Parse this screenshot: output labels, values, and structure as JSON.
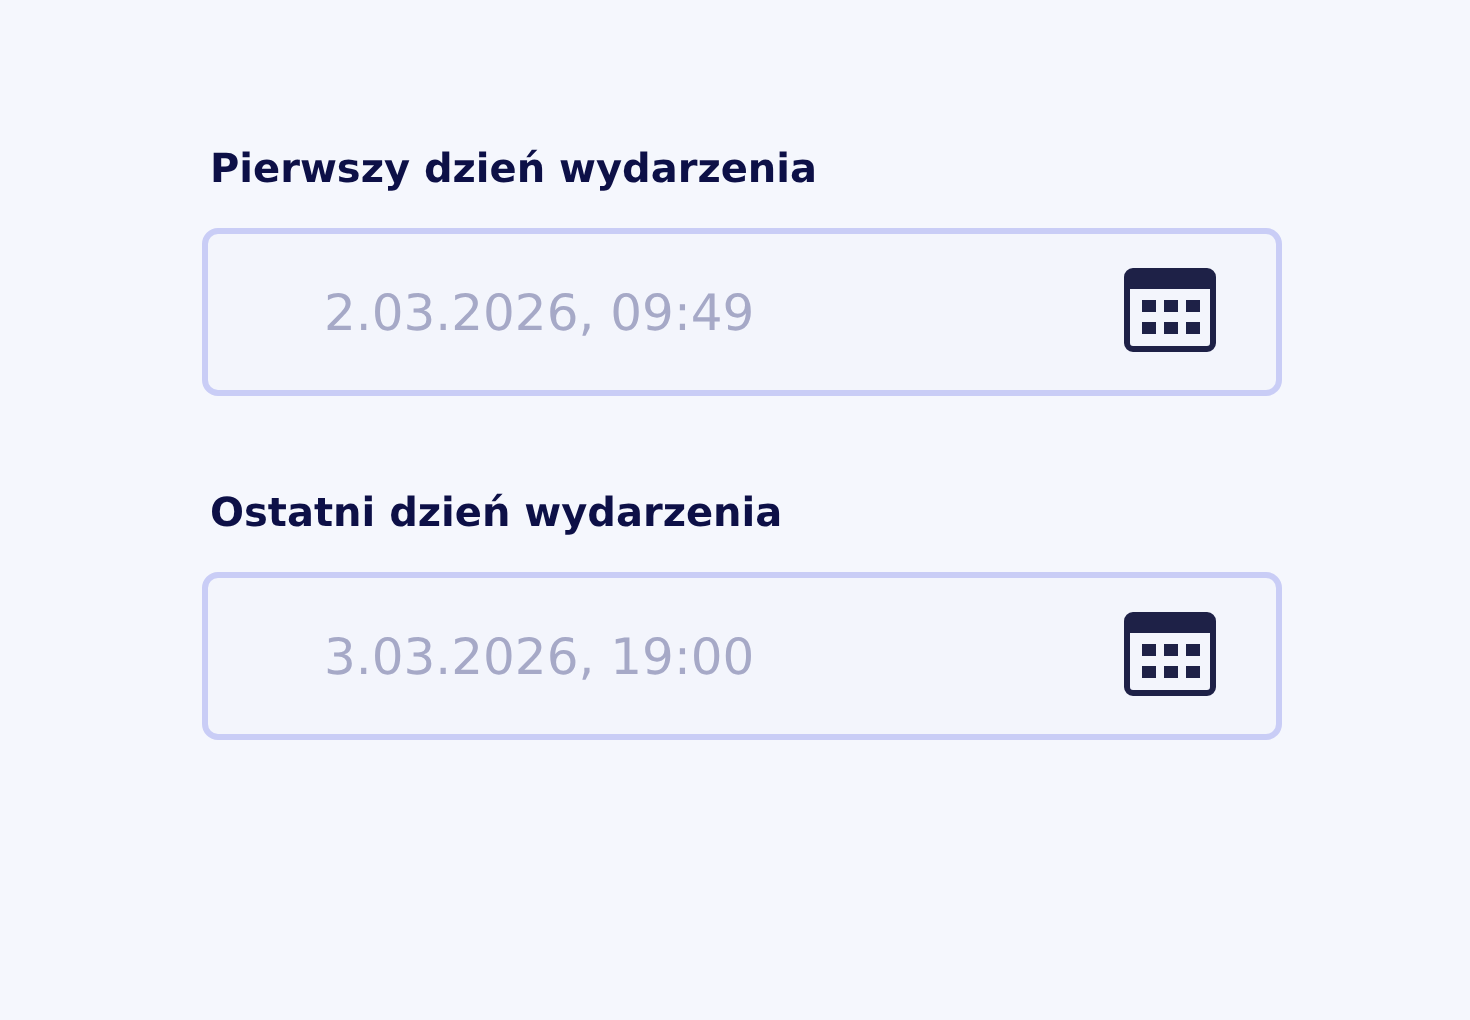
{
  "fields": [
    {
      "label": "Pierwszy dzień wydarzenia",
      "value": "2.03.2026, 09:49"
    },
    {
      "label": "Ostatni dzień wydarzenia",
      "value": "3.03.2026, 19:00"
    }
  ]
}
